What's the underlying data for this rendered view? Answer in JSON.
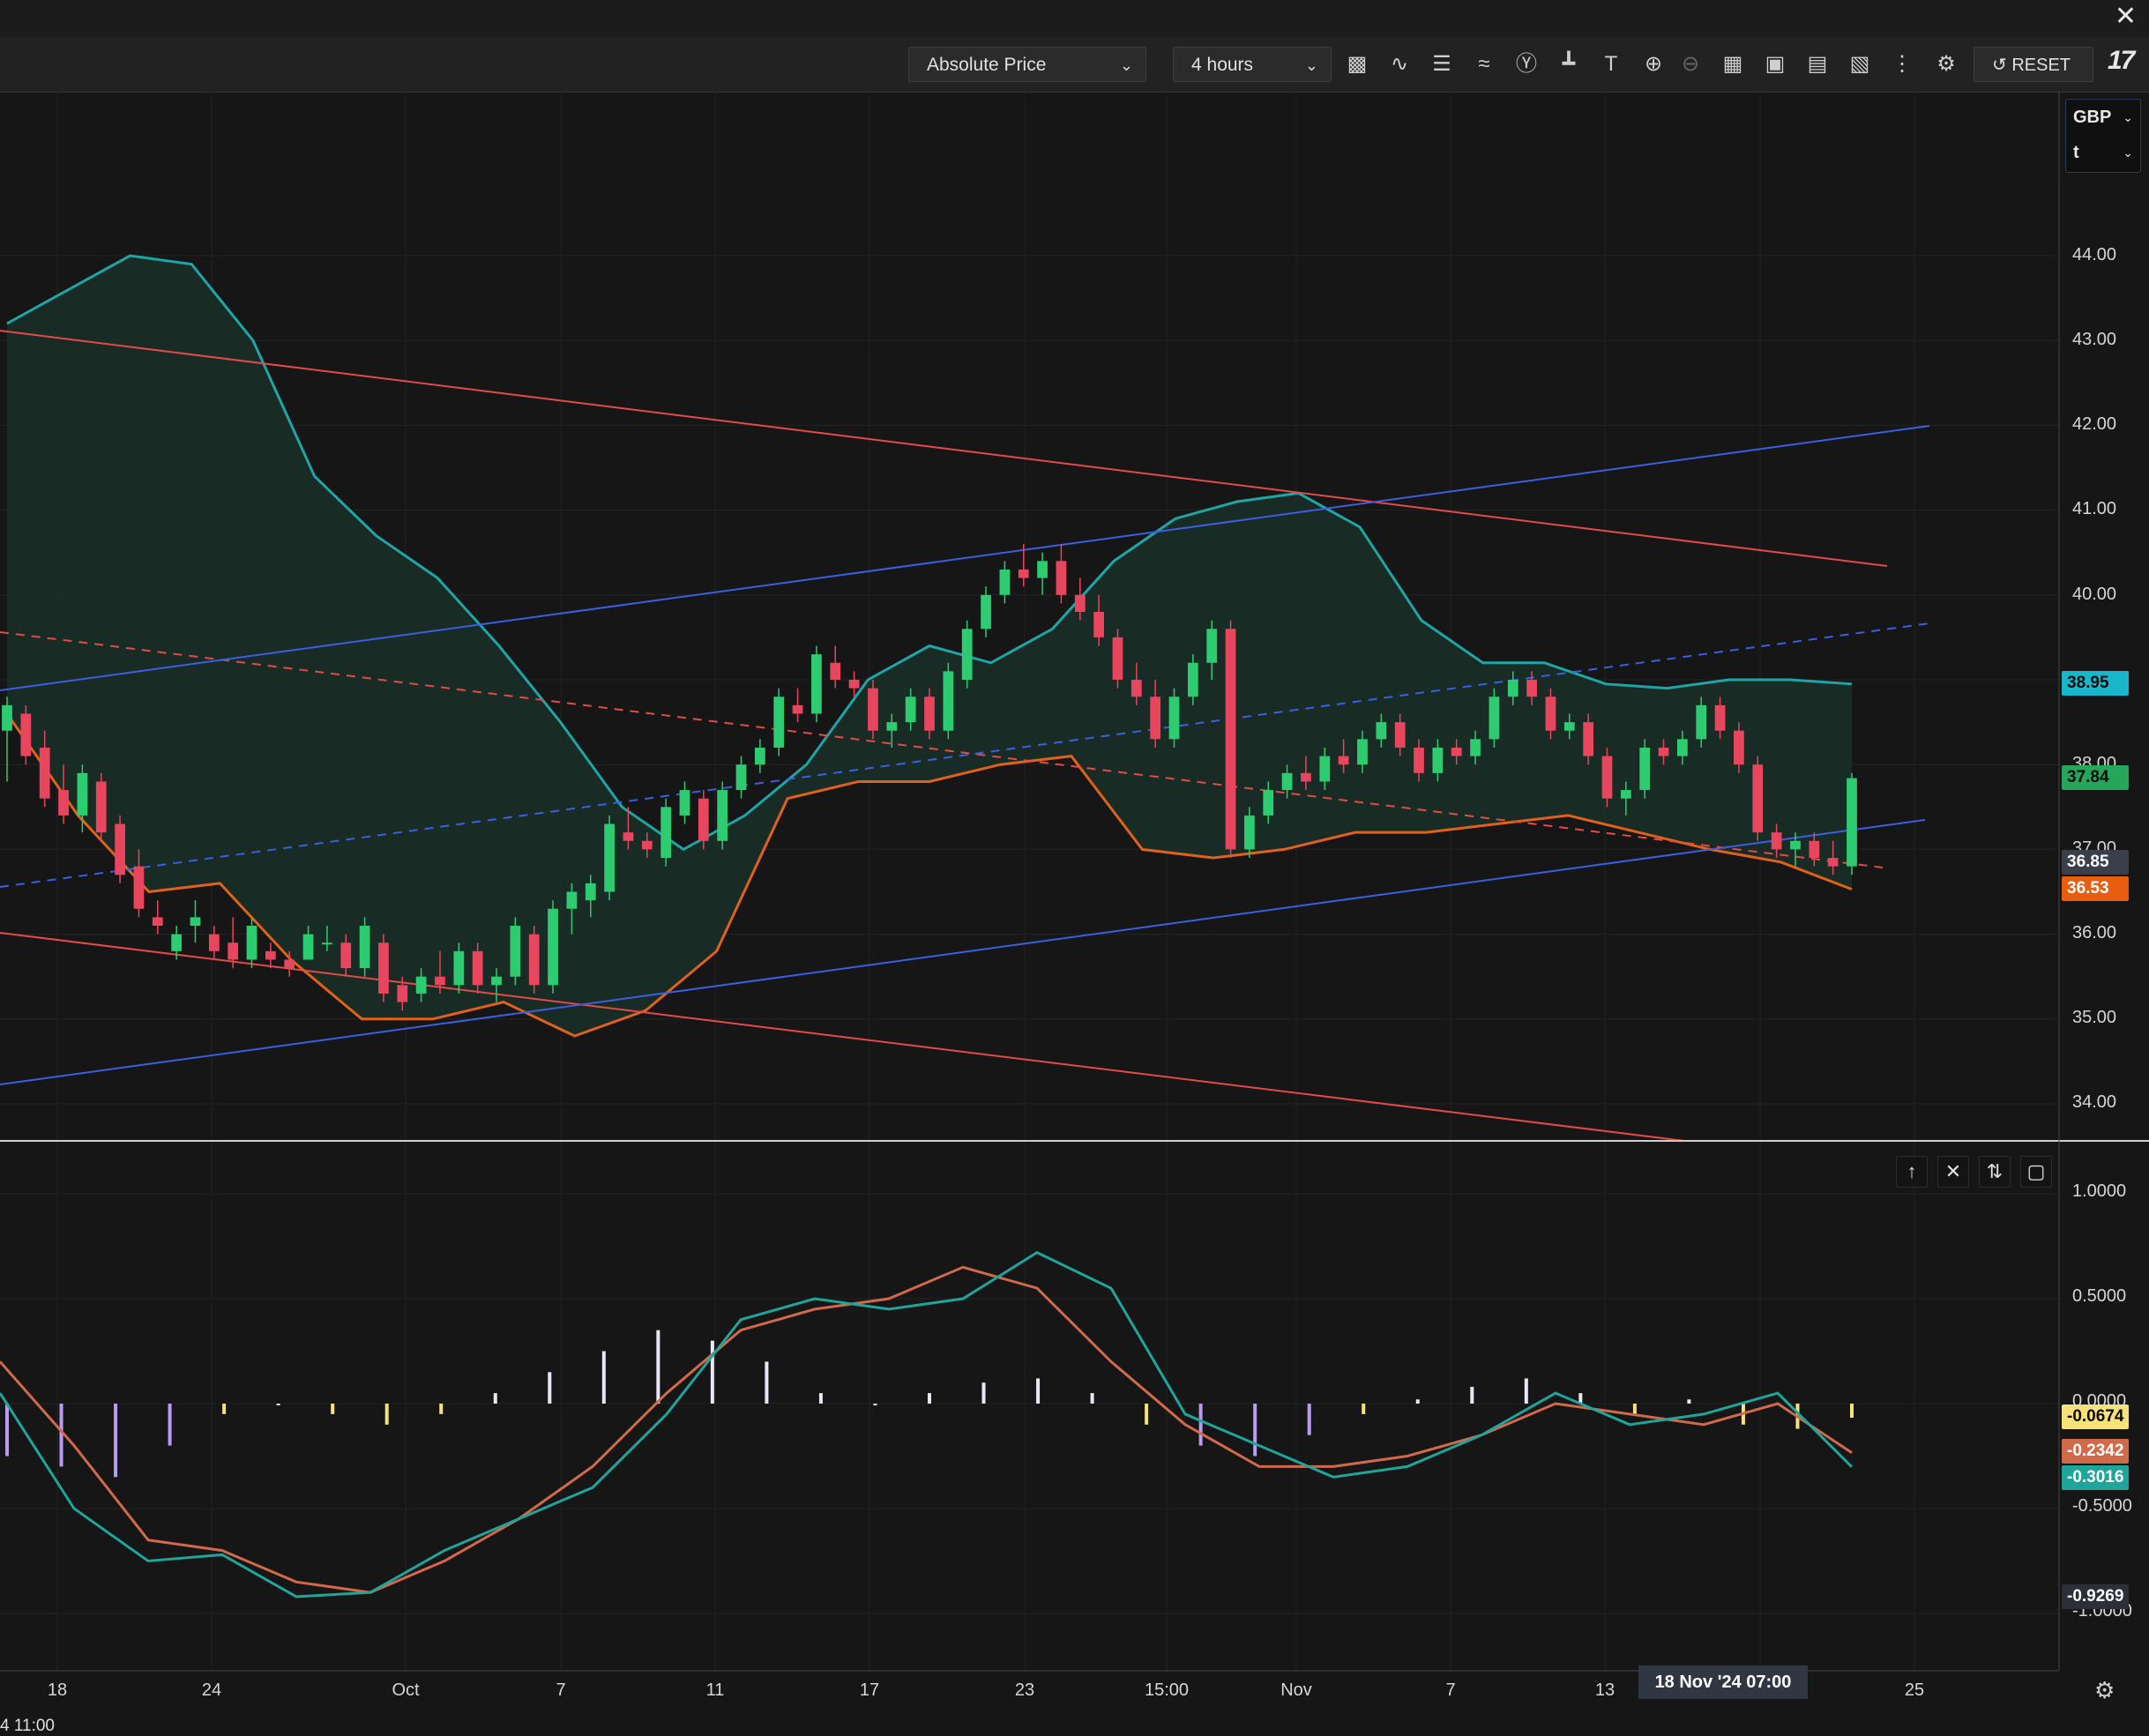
{
  "toolbar": {
    "price_mode": "Absolute Price",
    "interval": "4 hours",
    "reset_label": "RESET",
    "logo_text": "17",
    "close_symbol": "✕",
    "icons": [
      "candles-icon",
      "line-chart-icon",
      "bars-icon",
      "indicators-icon",
      "event-icon",
      "crosshair-tool-icon",
      "text-tool-icon",
      "zoom-in-icon",
      "zoom-out-icon",
      "table-icon",
      "layout-icon",
      "screenshot-icon",
      "compare-icon",
      "more-icon",
      "settings-icon"
    ]
  },
  "currency_selector": {
    "currency": "GBP",
    "unit": "t"
  },
  "price_axis": {
    "ticks": [
      "44.00",
      "43.00",
      "42.00",
      "41.00",
      "40.00",
      "38.00",
      "37.00",
      "36.00",
      "35.00",
      "34.00"
    ],
    "tags": [
      {
        "value": "38.95",
        "color": "#19b6c9",
        "text_color": "#0b0b0b"
      },
      {
        "value": "37.84",
        "color": "#26a65b",
        "text_color": "#0b0b0b"
      },
      {
        "value": "36.85",
        "color": "#3a3f4a",
        "text_color": "#ffffff"
      },
      {
        "value": "36.53",
        "color": "#e85d0e",
        "text_color": "#ffffff"
      }
    ]
  },
  "indicator_axis": {
    "ticks": [
      "1.0000",
      "0.5000",
      "0.0000",
      "-0.5000",
      "-1.0000"
    ],
    "tags": [
      {
        "value": "-0.0674",
        "color": "#f5e27a",
        "text_color": "#0b0b0b"
      },
      {
        "value": "-0.2342",
        "color": "#d06a4a",
        "text_color": "#ffffff"
      },
      {
        "value": "-0.3016",
        "color": "#1fa59a",
        "text_color": "#ffffff"
      },
      {
        "value": "-0.9269",
        "color": "#2a2f38",
        "text_color": "#ffffff"
      }
    ]
  },
  "time_axis": {
    "labels": [
      {
        "text": "18"
      },
      {
        "text": "24"
      },
      {
        "text": "Oct"
      },
      {
        "text": "7"
      },
      {
        "text": "11"
      },
      {
        "text": "17"
      },
      {
        "text": "23"
      },
      {
        "text": "15:00"
      },
      {
        "text": "Nov"
      },
      {
        "text": "7"
      },
      {
        "text": "13"
      },
      {
        "text": "25"
      }
    ],
    "crosshair_label": "18 Nov '24   07:00",
    "bottom_left_text": "4 11:00"
  },
  "indicator_pane_buttons": [
    "move-up-icon",
    "close-icon",
    "collapse-icon",
    "maximize-icon"
  ],
  "colors": {
    "up": "#2ecc71",
    "down": "#e8455f",
    "band_upper": "#1fa5a5",
    "band_lower": "#e0621a",
    "band_fill": "#1a2f28",
    "channel_red": "#e34b4b",
    "channel_blue": "#3b5fe0",
    "macd": "#1fa59a",
    "signal": "#d06a4a"
  },
  "chart_data": {
    "type": "candlestick",
    "ylim": [
      33.6,
      45.0
    ],
    "candles": [
      [
        38.4,
        38.8,
        37.8,
        38.7
      ],
      [
        38.6,
        38.7,
        38.0,
        38.1
      ],
      [
        38.2,
        38.4,
        37.5,
        37.6
      ],
      [
        37.7,
        38.0,
        37.3,
        37.4
      ],
      [
        37.4,
        38.0,
        37.2,
        37.9
      ],
      [
        37.8,
        37.9,
        37.1,
        37.2
      ],
      [
        37.3,
        37.4,
        36.6,
        36.7
      ],
      [
        36.8,
        37.0,
        36.2,
        36.3
      ],
      [
        36.2,
        36.4,
        36.0,
        36.1
      ],
      [
        35.8,
        36.1,
        35.7,
        36.0
      ],
      [
        36.1,
        36.4,
        35.9,
        36.2
      ],
      [
        36.0,
        36.1,
        35.7,
        35.8
      ],
      [
        35.9,
        36.2,
        35.6,
        35.7
      ],
      [
        35.7,
        36.2,
        35.6,
        36.1
      ],
      [
        35.8,
        35.9,
        35.6,
        35.7
      ],
      [
        35.7,
        35.8,
        35.5,
        35.6
      ],
      [
        35.7,
        36.1,
        35.7,
        36.0
      ],
      [
        35.9,
        36.1,
        35.8,
        35.9
      ],
      [
        35.9,
        36.0,
        35.5,
        35.6
      ],
      [
        35.6,
        36.2,
        35.5,
        36.1
      ],
      [
        35.9,
        36.0,
        35.2,
        35.3
      ],
      [
        35.4,
        35.5,
        35.1,
        35.2
      ],
      [
        35.3,
        35.6,
        35.2,
        35.5
      ],
      [
        35.5,
        35.8,
        35.3,
        35.4
      ],
      [
        35.4,
        35.9,
        35.3,
        35.8
      ],
      [
        35.8,
        35.9,
        35.3,
        35.4
      ],
      [
        35.4,
        35.6,
        35.2,
        35.5
      ],
      [
        35.5,
        36.2,
        35.4,
        36.1
      ],
      [
        36.0,
        36.1,
        35.3,
        35.4
      ],
      [
        35.4,
        36.4,
        35.3,
        36.3
      ],
      [
        36.3,
        36.6,
        36.0,
        36.5
      ],
      [
        36.4,
        36.7,
        36.2,
        36.6
      ],
      [
        36.5,
        37.4,
        36.4,
        37.3
      ],
      [
        37.2,
        37.5,
        37.0,
        37.1
      ],
      [
        37.1,
        37.2,
        36.9,
        37.0
      ],
      [
        36.9,
        37.6,
        36.8,
        37.5
      ],
      [
        37.4,
        37.8,
        37.3,
        37.7
      ],
      [
        37.6,
        37.7,
        37.0,
        37.1
      ],
      [
        37.1,
        37.8,
        37.0,
        37.7
      ],
      [
        37.7,
        38.1,
        37.6,
        38.0
      ],
      [
        38.0,
        38.3,
        37.9,
        38.2
      ],
      [
        38.2,
        38.9,
        38.1,
        38.8
      ],
      [
        38.7,
        38.9,
        38.5,
        38.6
      ],
      [
        38.6,
        39.4,
        38.5,
        39.3
      ],
      [
        39.2,
        39.4,
        38.9,
        39.0
      ],
      [
        39.0,
        39.1,
        38.8,
        38.9
      ],
      [
        38.9,
        39.0,
        38.3,
        38.4
      ],
      [
        38.4,
        38.6,
        38.2,
        38.5
      ],
      [
        38.5,
        38.9,
        38.4,
        38.8
      ],
      [
        38.8,
        38.9,
        38.3,
        38.4
      ],
      [
        38.4,
        39.2,
        38.3,
        39.1
      ],
      [
        39.0,
        39.7,
        38.9,
        39.6
      ],
      [
        39.6,
        40.1,
        39.5,
        40.0
      ],
      [
        40.0,
        40.4,
        39.9,
        40.3
      ],
      [
        40.3,
        40.6,
        40.1,
        40.2
      ],
      [
        40.2,
        40.5,
        40.0,
        40.4
      ],
      [
        40.4,
        40.6,
        39.9,
        40.0
      ],
      [
        40.0,
        40.2,
        39.7,
        39.8
      ],
      [
        39.8,
        40.0,
        39.4,
        39.5
      ],
      [
        39.5,
        39.6,
        38.9,
        39.0
      ],
      [
        39.0,
        39.2,
        38.7,
        38.8
      ],
      [
        38.8,
        39.0,
        38.2,
        38.3
      ],
      [
        38.3,
        38.9,
        38.2,
        38.8
      ],
      [
        38.8,
        39.3,
        38.7,
        39.2
      ],
      [
        39.2,
        39.7,
        39.0,
        39.6
      ],
      [
        39.6,
        39.7,
        36.9,
        37.0
      ],
      [
        37.0,
        37.5,
        36.9,
        37.4
      ],
      [
        37.4,
        37.8,
        37.3,
        37.7
      ],
      [
        37.7,
        38.0,
        37.6,
        37.9
      ],
      [
        37.9,
        38.1,
        37.7,
        37.8
      ],
      [
        37.8,
        38.2,
        37.7,
        38.1
      ],
      [
        38.1,
        38.3,
        37.9,
        38.0
      ],
      [
        38.0,
        38.4,
        37.9,
        38.3
      ],
      [
        38.3,
        38.6,
        38.2,
        38.5
      ],
      [
        38.5,
        38.6,
        38.1,
        38.2
      ],
      [
        38.2,
        38.3,
        37.8,
        37.9
      ],
      [
        37.9,
        38.3,
        37.8,
        38.2
      ],
      [
        38.2,
        38.3,
        38.0,
        38.1
      ],
      [
        38.1,
        38.4,
        38.0,
        38.3
      ],
      [
        38.3,
        38.9,
        38.2,
        38.8
      ],
      [
        38.8,
        39.1,
        38.7,
        39.0
      ],
      [
        39.0,
        39.1,
        38.7,
        38.8
      ],
      [
        38.8,
        38.9,
        38.3,
        38.4
      ],
      [
        38.4,
        38.6,
        38.3,
        38.5
      ],
      [
        38.5,
        38.6,
        38.0,
        38.1
      ],
      [
        38.1,
        38.2,
        37.5,
        37.6
      ],
      [
        37.6,
        37.8,
        37.4,
        37.7
      ],
      [
        37.7,
        38.3,
        37.6,
        38.2
      ],
      [
        38.2,
        38.3,
        38.0,
        38.1
      ],
      [
        38.1,
        38.4,
        38.0,
        38.3
      ],
      [
        38.3,
        38.8,
        38.2,
        38.7
      ],
      [
        38.7,
        38.8,
        38.3,
        38.4
      ],
      [
        38.4,
        38.5,
        37.9,
        38.0
      ],
      [
        38.0,
        38.1,
        37.1,
        37.2
      ],
      [
        37.2,
        37.3,
        36.9,
        37.0
      ],
      [
        37.0,
        37.2,
        36.8,
        37.1
      ],
      [
        37.1,
        37.2,
        36.8,
        36.9
      ],
      [
        36.9,
        37.1,
        36.7,
        36.8
      ],
      [
        36.8,
        37.9,
        36.7,
        37.84
      ]
    ],
    "bollinger_upper": [
      43.2,
      43.6,
      44.0,
      43.9,
      43.0,
      41.4,
      40.7,
      40.2,
      39.4,
      38.5,
      37.5,
      37.0,
      37.4,
      38.0,
      39.0,
      39.4,
      39.2,
      39.6,
      40.4,
      40.9,
      41.1,
      41.2,
      40.8,
      39.7,
      39.2,
      39.2,
      38.95,
      38.9,
      39.0,
      39.0,
      38.95
    ],
    "bollinger_lower": [
      38.6,
      37.4,
      36.5,
      36.6,
      35.7,
      35.0,
      35.0,
      35.2,
      34.8,
      35.1,
      35.8,
      37.6,
      37.8,
      37.8,
      38.0,
      38.1,
      37.0,
      36.9,
      37.0,
      37.2,
      37.2,
      37.3,
      37.4,
      37.2,
      37.0,
      36.85,
      36.53
    ],
    "macd_histogram": [
      -0.25,
      -0.3,
      -0.35,
      -0.2,
      -0.05,
      0.0,
      -0.05,
      -0.1,
      -0.05,
      0.05,
      0.15,
      0.25,
      0.35,
      0.3,
      0.2,
      0.05,
      0.0,
      0.05,
      0.1,
      0.12,
      0.05,
      -0.1,
      -0.2,
      -0.25,
      -0.15,
      -0.05,
      0.02,
      0.08,
      0.12,
      0.05,
      -0.05,
      0.02,
      -0.1,
      -0.12,
      -0.0674
    ],
    "macd_line": [
      0.05,
      -0.5,
      -0.75,
      -0.72,
      -0.92,
      -0.9,
      -0.7,
      -0.55,
      -0.4,
      -0.05,
      0.4,
      0.5,
      0.45,
      0.5,
      0.72,
      0.55,
      -0.05,
      -0.2,
      -0.35,
      -0.3,
      -0.15,
      0.05,
      -0.1,
      -0.05,
      0.05,
      -0.3016
    ],
    "signal_line": [
      0.2,
      -0.2,
      -0.65,
      -0.7,
      -0.85,
      -0.9,
      -0.75,
      -0.55,
      -0.3,
      0.05,
      0.35,
      0.45,
      0.5,
      0.65,
      0.55,
      0.2,
      -0.1,
      -0.3,
      -0.3,
      -0.25,
      -0.15,
      0.0,
      -0.05,
      -0.1,
      0.0,
      -0.2342
    ]
  }
}
